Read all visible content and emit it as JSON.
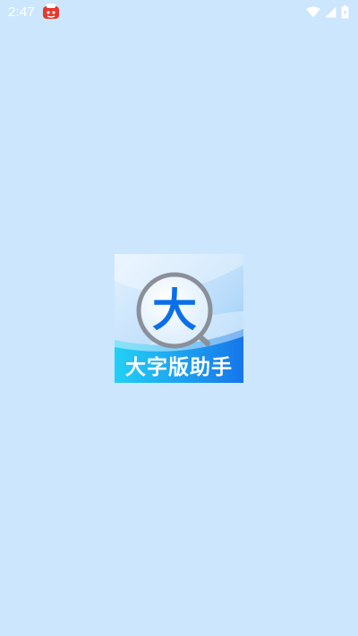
{
  "status_bar": {
    "time": "2:47",
    "notification_icon": "app-notification-icon",
    "wifi_icon": "wifi-icon",
    "signal_icon": "cell-signal-icon",
    "battery_icon": "battery-icon"
  },
  "splash": {
    "logo_char": "大",
    "logo_caption": "大字版助手",
    "colors": {
      "background": "#cce6fe",
      "brand_blue": "#0a6fea",
      "caption_band": "#1f8cf0"
    }
  }
}
